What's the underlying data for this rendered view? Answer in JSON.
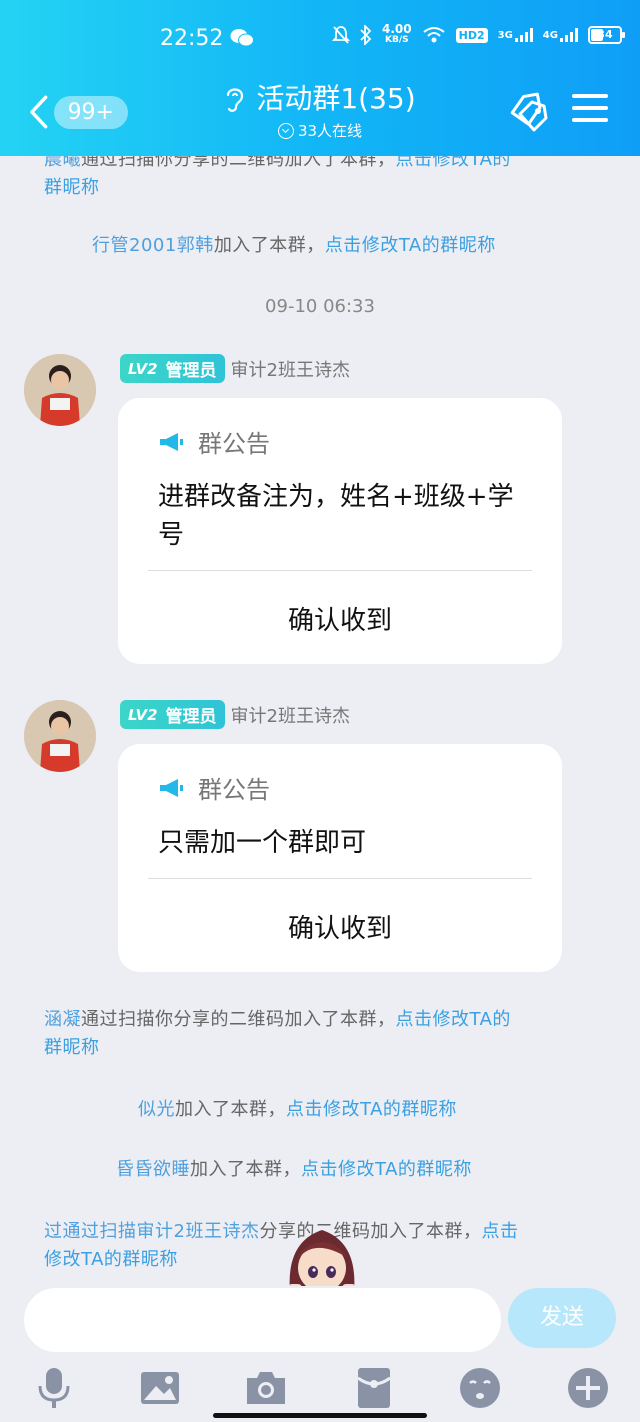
{
  "status_bar": {
    "time": "22:52",
    "speed_value": "4.00",
    "speed_unit": "KB/S",
    "hd": "HD2",
    "net1": "3G",
    "net2": "4G",
    "battery": "34"
  },
  "header": {
    "unread_badge": "99+",
    "title": "活动群1(35)",
    "online": "33人在线"
  },
  "messages": {
    "sys1": {
      "name": "晨曦",
      "text": "通过扫描你分享的二维码加入了本群，",
      "link": "点击修改TA的",
      "link2": "群昵称"
    },
    "sys2": {
      "name": "行管2001郭韩",
      "text": "加入了本群，",
      "link": "点击修改TA的群昵称"
    },
    "timestamp": "09-10 06:33",
    "notice1": {
      "role_level": "LV2",
      "role": "管理员",
      "sender": "审计2班王诗杰",
      "heading": "群公告",
      "body": "进群改备注为，姓名+班级+学号",
      "confirm": "确认收到"
    },
    "notice2": {
      "role_level": "LV2",
      "role": "管理员",
      "sender": "审计2班王诗杰",
      "heading": "群公告",
      "body": "只需加一个群即可",
      "confirm": "确认收到"
    },
    "sys3": {
      "name": "涵凝",
      "text": "通过扫描你分享的二维码加入了本群，",
      "link": "点击修改TA的",
      "link2": "群昵称"
    },
    "sys4": {
      "name": "似光",
      "text": "加入了本群，",
      "link": "点击修改TA的群昵称"
    },
    "sys5": {
      "name": "昏昏欲睡",
      "text": "加入了本群，",
      "link": "点击修改TA的群昵称"
    },
    "sys6": {
      "text_a": "过通过扫描",
      "name": "审计2班王诗杰",
      "text_b": "分享的二维码加入了本群，",
      "link": "点击",
      "link2": "修改TA的群昵称"
    }
  },
  "input_bar": {
    "placeholder": "",
    "send_label": "发送"
  },
  "toolbar_icons": [
    "microphone-icon",
    "image-icon",
    "camera-icon",
    "red-packet-icon",
    "emoji-icon",
    "plus-icon"
  ],
  "colors": {
    "header_start": "#24d3f4",
    "header_end": "#0f9ef7",
    "link": "#3aa0e2",
    "role_badge": "#3cd6c8",
    "background": "#eceef4"
  }
}
